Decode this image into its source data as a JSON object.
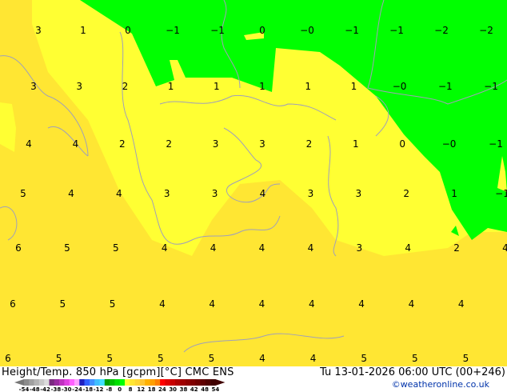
{
  "map": {
    "colors": {
      "warm_yellow": "#ffe633",
      "bright_yellow": "#ffff33",
      "green": "#00ff00",
      "coast": "#a0a0b8"
    },
    "labels_rows": [
      [
        "3",
        "1",
        "0",
        "-1",
        "-1",
        "0",
        "-0",
        "-1",
        "-1",
        "-2",
        "-2"
      ],
      [
        "3",
        "3",
        "2",
        "1",
        "1",
        "1",
        "1",
        "1",
        "-0",
        "-1",
        "-1"
      ],
      [
        "4",
        "4",
        "2",
        "2",
        "3",
        "3",
        "2",
        "1",
        "0",
        "-0",
        "-1"
      ],
      [
        "5",
        "4",
        "4",
        "3",
        "3",
        "4",
        "3",
        "3",
        "2",
        "1",
        "-1"
      ],
      [
        "6",
        "5",
        "5",
        "4",
        "4",
        "4",
        "4",
        "3",
        "4",
        "2",
        "4"
      ],
      [
        "6",
        "5",
        "5",
        "4",
        "4",
        "4",
        "4",
        "4",
        "4",
        "4"
      ],
      [
        "6",
        "5",
        "5",
        "5",
        "5",
        "4",
        "4",
        "5",
        "5",
        "5"
      ]
    ]
  },
  "footer": {
    "title": "Height/Temp. 850 hPa [gcpm][°C] CMC ENS",
    "datetime": "Tu 13-01-2026 06:00 UTC (00+246)",
    "credit": "©weatheronline.co.uk",
    "scale_ticks": [
      "-54",
      "-48",
      "-42",
      "-38",
      "-30",
      "-24",
      "-18",
      "-12",
      "-8",
      "0",
      "8",
      "12",
      "18",
      "24",
      "30",
      "38",
      "42",
      "48",
      "54"
    ],
    "scale_colors": [
      "#8c8c8c",
      "#a0a0a0",
      "#b4b4b4",
      "#c8c8c8",
      "#dcdcdc",
      "#7a2a80",
      "#9a2aa0",
      "#c030c0",
      "#e040e0",
      "#ff60ff",
      "#ffa0ff",
      "#2020c0",
      "#3060ff",
      "#4090ff",
      "#40c0ff",
      "#40e0ff",
      "#00a000",
      "#00c000",
      "#00e000",
      "#00ff00",
      "#ffff33",
      "#ffe633",
      "#ffd633",
      "#ffc633",
      "#ffb000",
      "#ffa000",
      "#ff8000",
      "#ff0000",
      "#e00000",
      "#c80000",
      "#b00000",
      "#a00000",
      "#900000",
      "#800000",
      "#700000",
      "#600000",
      "#500000",
      "#400000"
    ]
  }
}
